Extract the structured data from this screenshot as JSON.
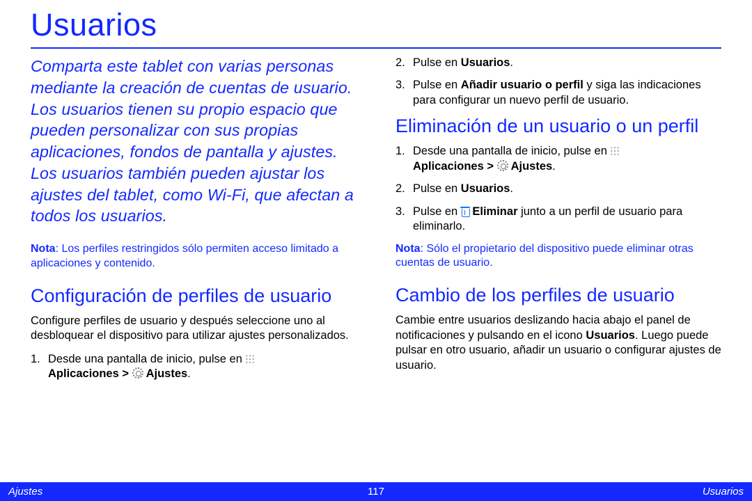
{
  "title": "Usuarios",
  "intro": "Comparta este tablet con varias personas mediante la creación de cuentas de usuario. Los usuarios tienen su propio espacio que pueden personalizar con sus propias aplicaciones, fondos de pantalla y ajustes. Los usuarios también pueden ajustar los ajustes del tablet, como Wi-Fi, que afectan a todos los usuarios.",
  "note1_label": "Nota",
  "note1_text": ": Los perfiles restringidos sólo permiten acceso limitado a aplicaciones y contenido.",
  "section1": {
    "heading": "Configuración de perfiles de usuario",
    "para": "Configure perfiles de usuario y después seleccione uno al desbloquear el dispositivo para utilizar ajustes personalizados.",
    "step1_pre": "Desde una pantalla de inicio, pulse en ",
    "step1_bold": "Aplicaciones > ",
    "step1_bold2": " Ajustes",
    "step1_tail": "."
  },
  "col2": {
    "step2_pre": "Pulse en ",
    "step2_bold": "Usuarios",
    "step2_tail": ".",
    "step3_pre": "Pulse en ",
    "step3_bold": "Añadir usuario o perfil",
    "step3_tail": " y siga las indicaciones para configurar un nuevo perfil de usuario."
  },
  "section2": {
    "heading": "Eliminación de un usuario o un perfil",
    "s1_pre": "Desde una pantalla de inicio, pulse en ",
    "s1_bold": "Aplicaciones > ",
    "s1_bold2": " Ajustes",
    "s1_tail": ".",
    "s2_pre": "Pulse en ",
    "s2_bold": "Usuarios",
    "s2_tail": ".",
    "s3_pre": "Pulse en ",
    "s3_bold": " Eliminar",
    "s3_tail": " junto a un perfil de usuario para eliminarlo.",
    "note_label": "Nota",
    "note_text": ": Sólo el propietario del dispositivo puede eliminar otras cuentas de usuario."
  },
  "section3": {
    "heading": "Cambio de los perfiles de usuario",
    "para_pre": "Cambie entre usuarios deslizando hacia abajo el panel de notificaciones y pulsando en el icono ",
    "para_bold": "Usuarios",
    "para_tail": ". Luego puede pulsar en otro usuario, añadir un usuario o configurar ajustes de usuario."
  },
  "footer": {
    "left": "Ajustes",
    "center": "117",
    "right": "Usuarios"
  }
}
